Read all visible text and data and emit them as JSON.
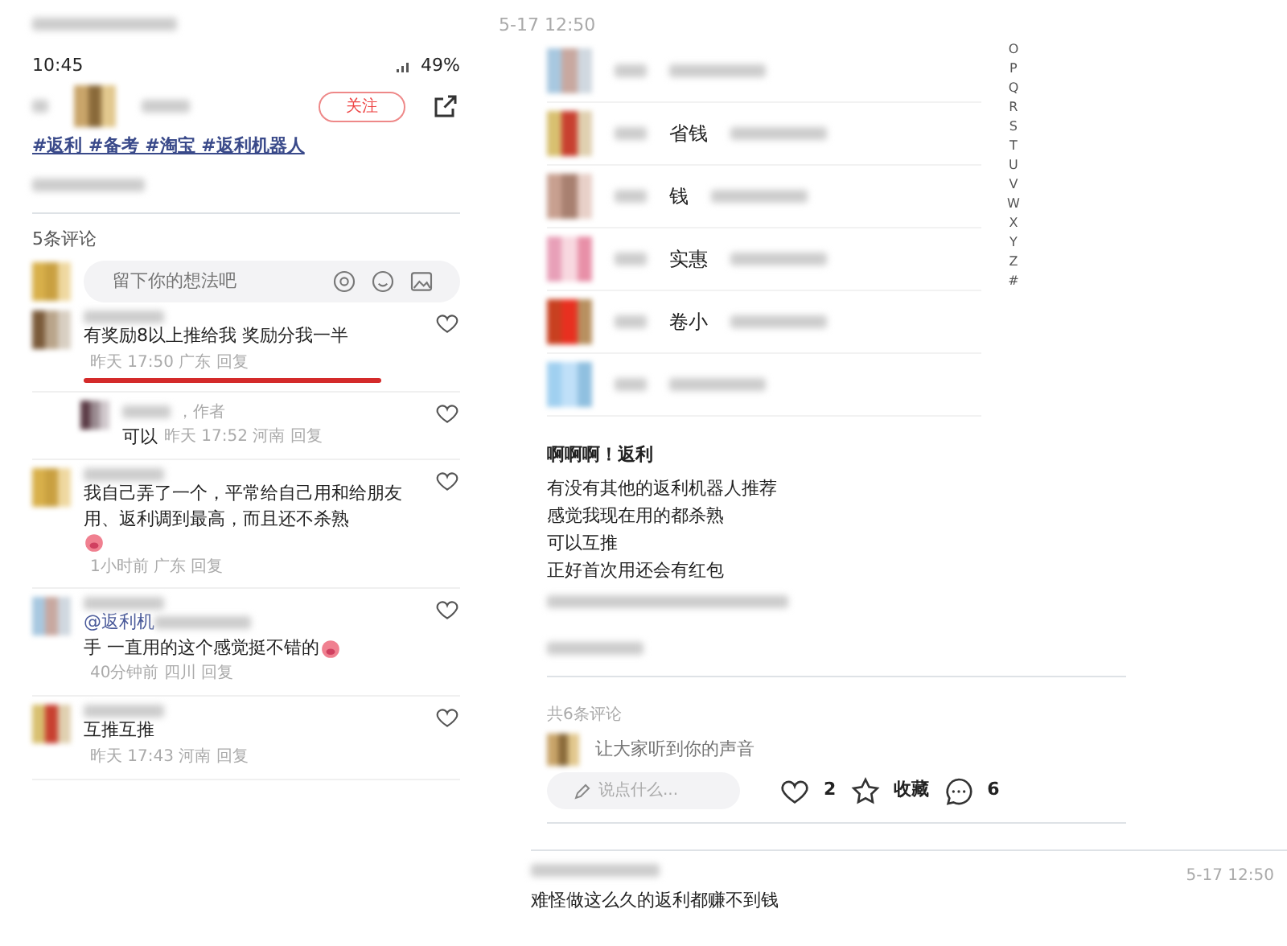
{
  "left_screen": {
    "status_bar": {
      "time": "10:45",
      "battery": "49%"
    },
    "author": {
      "follow_button": "关注"
    },
    "hashtags": "#返利 #备考 #淘宝 #返利机器人",
    "comments_header": "5条评论",
    "comment_input": {
      "placeholder": "留下你的想法吧"
    },
    "comments": [
      {
        "kind": "comment",
        "text": "有奖励8以上推给我 奖励分我一半",
        "meta": "昨天 17:50 广东 回复",
        "underlined": true,
        "emoji": false
      },
      {
        "kind": "reply",
        "author_tag": "，作者",
        "text": "可以",
        "meta": "昨天 17:52 河南 回复",
        "underlined": false,
        "emoji": false
      },
      {
        "kind": "comment",
        "text": "我自己弄了一个，平常给自己用和给朋友用、返利调到最高，而且还不杀熟",
        "meta": "1小时前 广东 回复",
        "underlined": false,
        "emoji": true
      },
      {
        "kind": "comment",
        "mention": "@返利机",
        "text": "手 一直用的这个感觉挺不错的",
        "meta": "40分钟前 四川 回复",
        "underlined": false,
        "emoji": true
      },
      {
        "kind": "comment",
        "text": "互推互推",
        "meta": "昨天 17:43 河南 回复",
        "underlined": false,
        "emoji": false
      }
    ]
  },
  "right_screen": {
    "timestamp": "5-17 12:50",
    "contacts": [
      {
        "kind": "blurred"
      },
      {
        "kind": "named",
        "name": "省钱"
      },
      {
        "kind": "named",
        "name": "钱"
      },
      {
        "kind": "named",
        "name": "实惠"
      },
      {
        "kind": "named",
        "name": "卷小"
      },
      {
        "kind": "blurred"
      }
    ],
    "alphabet_index": [
      "O",
      "P",
      "Q",
      "R",
      "S",
      "T",
      "U",
      "V",
      "W",
      "X",
      "Y",
      "Z",
      "#"
    ],
    "post": {
      "title": "啊啊啊！返利",
      "lines": [
        "有没有其他的返利机器人推荐",
        "感觉我现在用的都杀熟",
        "可以互推",
        "正好首次用还会有红包"
      ]
    },
    "comments_header": "共6条评论",
    "comment_input": {
      "placeholder": "让大家听到你的声音"
    },
    "bottom_bar": {
      "input_placeholder": "说点什么...",
      "likes": "2",
      "favorite": "收藏",
      "comments": "6"
    },
    "next_message": {
      "timestamp": "5-17 12:50",
      "text": "难怪做这么久的返利都赚不到钱"
    }
  }
}
